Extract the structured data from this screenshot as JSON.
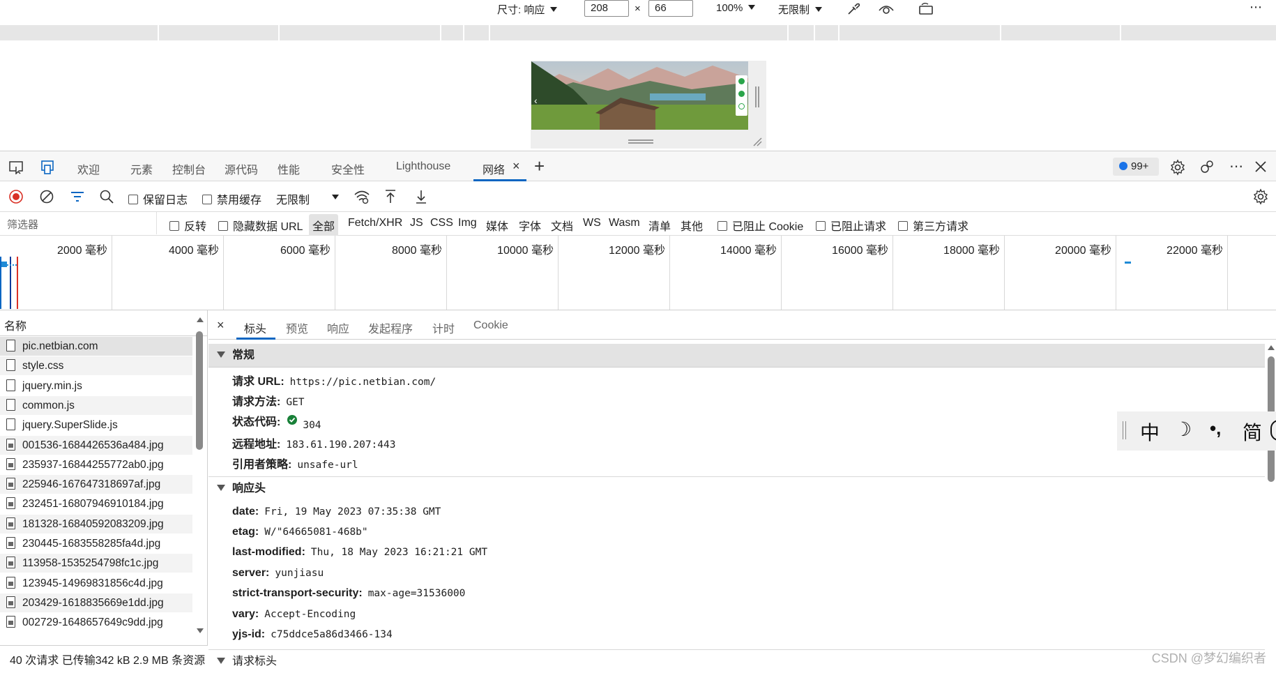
{
  "device_toolbar": {
    "size_label": "尺寸: 响应",
    "width": "208",
    "times": "×",
    "height": "66",
    "zoom": "100%",
    "throttle": "无限制",
    "more": "⋯"
  },
  "devtools_tabs": {
    "items": [
      {
        "label": "欢迎"
      },
      {
        "label": "元素"
      },
      {
        "label": "控制台"
      },
      {
        "label": "源代码"
      },
      {
        "label": "性能"
      },
      {
        "label": "安全性"
      },
      {
        "label": "Lighthouse"
      },
      {
        "label": "网络",
        "active": true
      }
    ],
    "close_tab": "×",
    "add": "+",
    "issues_badge": "99+"
  },
  "network_toolbar": {
    "preserve_log": "保留日志",
    "disable_cache": "禁用缓存",
    "throttle": "无限制"
  },
  "filter_bar": {
    "placeholder": "筛选器",
    "invert": "反转",
    "hide_data_url": "隐藏数据 URL",
    "types": [
      "全部",
      "Fetch/XHR",
      "JS",
      "CSS",
      "Img",
      "媒体",
      "字体",
      "文档",
      "WS",
      "Wasm",
      "清单",
      "其他"
    ],
    "blocked_cookies": "已阻止 Cookie",
    "blocked_requests": "已阻止请求",
    "third_party": "第三方请求"
  },
  "timeline": {
    "ticks": [
      "2000 毫秒",
      "4000 毫秒",
      "6000 毫秒",
      "8000 毫秒",
      "10000 毫秒",
      "12000 毫秒",
      "14000 毫秒",
      "16000 毫秒",
      "18000 毫秒",
      "20000 毫秒",
      "22000 毫秒"
    ]
  },
  "request_list": {
    "header": "名称",
    "rows": [
      {
        "name": "pic.netbian.com",
        "selected": true
      },
      {
        "name": "style.css"
      },
      {
        "name": "jquery.min.js"
      },
      {
        "name": "common.js"
      },
      {
        "name": "jquery.SuperSlide.js"
      },
      {
        "name": "001536-1684426536a484.jpg"
      },
      {
        "name": "235937-16844255772ab0.jpg"
      },
      {
        "name": "225946-167647318697af.jpg"
      },
      {
        "name": "232451-16807946910184.jpg"
      },
      {
        "name": "181328-16840592083209.jpg"
      },
      {
        "name": "230445-1683558285fa4d.jpg"
      },
      {
        "name": "113958-1535254798fc1c.jpg"
      },
      {
        "name": "123945-14969831856c4d.jpg"
      },
      {
        "name": "203429-1618835669e1dd.jpg"
      },
      {
        "name": "002729-1648657649c9dd.jpg"
      }
    ]
  },
  "details": {
    "close": "×",
    "tabs": [
      "标头",
      "预览",
      "响应",
      "发起程序",
      "计时",
      "Cookie"
    ],
    "general": {
      "title": "常规",
      "items": [
        {
          "key": "请求 URL:",
          "value": "https://pic.netbian.com/"
        },
        {
          "key": "请求方法:",
          "value": "GET"
        },
        {
          "key": "状态代码:",
          "value": "304"
        },
        {
          "key": "远程地址:",
          "value": "183.61.190.207:443"
        },
        {
          "key": "引用者策略:",
          "value": "unsafe-url"
        }
      ]
    },
    "response_headers": {
      "title": "响应头",
      "items": [
        {
          "key": "date:",
          "value": "Fri, 19 May 2023 07:35:38 GMT"
        },
        {
          "key": "etag:",
          "value": "W/\"64665081-468b\""
        },
        {
          "key": "last-modified:",
          "value": "Thu, 18 May 2023 16:21:21 GMT"
        },
        {
          "key": "server:",
          "value": "yunjiasu"
        },
        {
          "key": "strict-transport-security:",
          "value": "max-age=31536000"
        },
        {
          "key": "vary:",
          "value": "Accept-Encoding"
        },
        {
          "key": "yjs-id:",
          "value": "c75ddce5a86d3466-134"
        }
      ]
    },
    "request_headers": {
      "title": "请求标头"
    }
  },
  "ime": {
    "items": [
      "中",
      "☽",
      "•,",
      "简"
    ]
  },
  "status": {
    "text": "40 次请求  已传输342 kB  2.9 MB 条资源"
  },
  "watermark": "CSDN @梦幻编织者",
  "colors": {
    "accent": "#0a66c2",
    "record": "#d93025",
    "status_ok": "#188038"
  }
}
